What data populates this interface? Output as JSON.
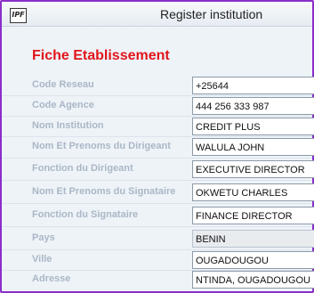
{
  "window": {
    "title": "Register institution",
    "icon": "IPF"
  },
  "form": {
    "heading": "Fiche Etablissement",
    "fields": [
      {
        "label": "Code Reseau",
        "value": "+25644"
      },
      {
        "label": "Code Agence",
        "value": "444 256 333 987"
      },
      {
        "label": "Nom Institution",
        "value": "CREDIT PLUS"
      },
      {
        "label": "Nom Et Prenoms du Dirigeant",
        "value": "WALULA JOHN"
      },
      {
        "label": "Fonction du Dirigeant",
        "value": "EXECUTIVE DIRECTOR"
      },
      {
        "label": "Nom Et Prenoms du Signataire",
        "value": "OKWETU CHARLES"
      },
      {
        "label": "Fonction du Signataire",
        "value": "FINANCE DIRECTOR"
      },
      {
        "label": "Pays",
        "value": "BENIN"
      },
      {
        "label": "Ville",
        "value": "OUGADOUGOU"
      },
      {
        "label": "Adresse",
        "value": "NTINDA, OUGADOUGOU"
      }
    ]
  },
  "colors": {
    "heading": "#e0161b",
    "label": "#aab7c6",
    "window_border": "#8b2fc9"
  }
}
